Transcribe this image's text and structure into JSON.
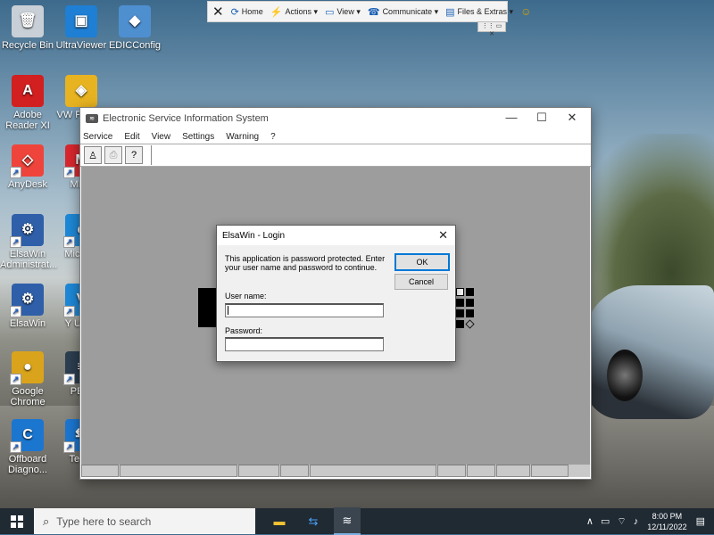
{
  "desktop": {
    "icons": [
      {
        "label": "Recycle Bin",
        "icon": "recycle-bin-icon",
        "color": "#c8cfd6",
        "sym": "🗑"
      },
      {
        "label": "UltraViewer",
        "icon": "ultraviewer-icon",
        "color": "#1e7fd4",
        "sym": "▣"
      },
      {
        "label": "EDICConfig",
        "icon": "ediconfig-icon",
        "color": "#4e8fd0",
        "sym": "◆"
      },
      {
        "label": "Adobe Reader XI",
        "icon": "adobe-reader-icon",
        "color": "#d21f1f",
        "sym": "A"
      },
      {
        "label": "VW PDX-C",
        "icon": "vw-pdx-icon",
        "color": "#e8b320",
        "sym": "◈"
      },
      {
        "label": "AnyDesk",
        "icon": "anydesk-icon",
        "color": "#ef443b",
        "sym": "◇"
      },
      {
        "label": "MEG",
        "icon": "mega-icon",
        "color": "#d9272e",
        "sym": "M"
      },
      {
        "label": "ElsaWin Administrat...",
        "icon": "elsawin-admin-icon",
        "color": "#2e5fa8",
        "sym": "⚙"
      },
      {
        "label": "Micr Ed",
        "icon": "microsoft-edge-icon",
        "color": "#1e88d8",
        "sym": "e"
      },
      {
        "label": "ElsaWin",
        "icon": "elsawin-icon",
        "color": "#2e5fa8",
        "sym": "⚙"
      },
      {
        "label": "Y Unin-",
        "icon": "uninstall-icon",
        "color": "#1e88d8",
        "sym": "V"
      },
      {
        "label": "Google Chrome",
        "icon": "chrome-icon",
        "color": "#d9a41c",
        "sym": "●"
      },
      {
        "label": "PETI",
        "icon": "peti-icon",
        "color": "#2c3e50",
        "sym": "≡"
      },
      {
        "label": "Offboard Diagno...",
        "icon": "offboard-diagnostic-icon",
        "color": "#1b76d0",
        "sym": "C"
      },
      {
        "label": "Team",
        "icon": "teamviewer-icon",
        "color": "#1b76d0",
        "sym": "⇆"
      }
    ]
  },
  "teamviewer": {
    "home": "Home",
    "actions": "Actions",
    "view": "View",
    "communicate": "Communicate",
    "files": "Files & Extras"
  },
  "app": {
    "title": "Electronic Service Information System",
    "menu": [
      "Service",
      "Edit",
      "View",
      "Settings",
      "Warning",
      "?"
    ]
  },
  "dialog": {
    "title": "ElsaWin - Login",
    "message": "This application is password protected. Enter your user name and password to continue.",
    "user_label": "User name:",
    "password_label": "Password:",
    "ok": "OK",
    "cancel": "Cancel"
  },
  "taskbar": {
    "search_placeholder": "Type here to search",
    "time": "8:00 PM",
    "date": "12/11/2022"
  }
}
